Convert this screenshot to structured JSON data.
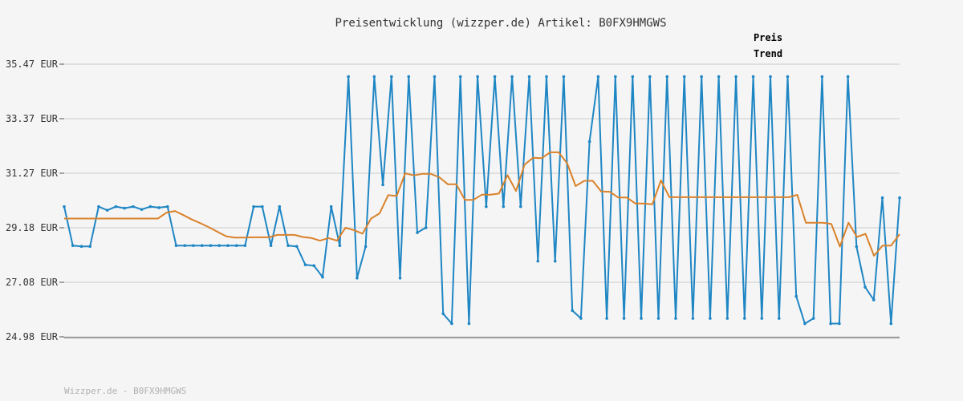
{
  "footer": "Wizzper.de - B0FX9HMGWS",
  "colors": {
    "background": "#f5f5f5",
    "grid": "#e0e0e0",
    "price": "#1f86c4",
    "trend": "#d9822b"
  },
  "chart_data": {
    "type": "line",
    "title": "Preisentwicklung (wizzper.de) Artikel: B0FX9HMGWS",
    "xlabel": "",
    "ylabel": "",
    "ylim": [
      24.98,
      35.47
    ],
    "y_ticks": [
      "35.47 EUR",
      "33.37 EUR",
      "31.27 EUR",
      "29.18 EUR",
      "27.08 EUR",
      "24.98 EUR"
    ],
    "grid": true,
    "legend_position": "top-right",
    "series": [
      {
        "name": "Preis",
        "color": "#1f86c4",
        "values": [
          29.99,
          28.49,
          28.46,
          28.46,
          29.99,
          29.85,
          29.99,
          29.93,
          29.99,
          29.88,
          29.99,
          29.95,
          29.99,
          28.49,
          28.49,
          28.49,
          28.49,
          28.49,
          28.49,
          28.49,
          28.49,
          28.49,
          29.99,
          29.99,
          28.49,
          29.99,
          28.49,
          28.46,
          27.75,
          27.72,
          27.28,
          29.99,
          28.49,
          34.99,
          27.24,
          28.45,
          34.99,
          30.83,
          34.99,
          27.24,
          34.99,
          28.99,
          29.18,
          34.99,
          25.87,
          25.49,
          34.99,
          25.49,
          34.99,
          29.99,
          34.99,
          29.99,
          34.99,
          29.99,
          34.99,
          27.89,
          34.99,
          27.89,
          34.99,
          25.99,
          25.69,
          32.49,
          34.99,
          25.69,
          34.99,
          25.69,
          34.99,
          25.69,
          34.99,
          25.69,
          34.99,
          25.69,
          34.99,
          25.69,
          34.99,
          25.69,
          34.99,
          25.69,
          34.99,
          25.69,
          34.99,
          25.69,
          34.99,
          25.69,
          34.99,
          26.54,
          25.49,
          25.69,
          34.99,
          25.49,
          25.49,
          34.99,
          28.45,
          26.89,
          26.4,
          30.33,
          25.49,
          30.33
        ]
      },
      {
        "name": "Trend",
        "color": "#d9822b",
        "values": [
          29.53,
          29.53,
          29.53,
          29.53,
          29.53,
          29.53,
          29.53,
          29.53,
          29.53,
          29.53,
          29.53,
          29.53,
          29.76,
          29.82,
          29.66,
          29.49,
          29.35,
          29.19,
          29.02,
          28.85,
          28.8,
          28.8,
          28.81,
          28.81,
          28.81,
          28.9,
          28.9,
          28.9,
          28.82,
          28.78,
          28.68,
          28.78,
          28.68,
          29.18,
          29.08,
          28.95,
          29.53,
          29.73,
          30.43,
          30.4,
          31.27,
          31.19,
          31.25,
          31.25,
          31.12,
          30.85,
          30.85,
          30.25,
          30.25,
          30.45,
          30.45,
          30.49,
          31.2,
          30.59,
          31.6,
          31.87,
          31.85,
          32.08,
          32.08,
          31.66,
          30.78,
          30.98,
          30.98,
          30.57,
          30.56,
          30.34,
          30.34,
          30.11,
          30.11,
          30.08,
          31.0,
          30.35,
          30.35,
          30.35,
          30.35,
          30.35,
          30.35,
          30.35,
          30.35,
          30.35,
          30.35,
          30.35,
          30.35,
          30.35,
          30.35,
          30.35,
          30.44,
          29.37,
          29.37,
          29.37,
          29.32,
          28.45,
          29.37,
          28.82,
          28.94,
          28.1,
          28.49,
          28.49,
          28.93
        ]
      }
    ]
  }
}
